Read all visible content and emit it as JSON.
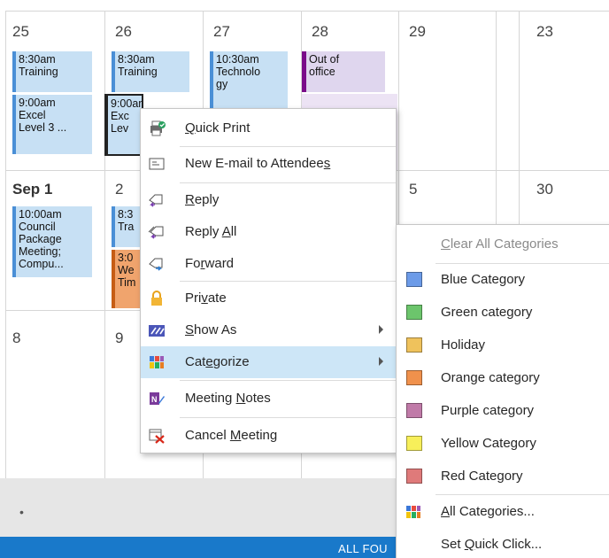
{
  "calendar": {
    "row1": [
      "25",
      "26",
      "27",
      "28",
      "29",
      "23"
    ],
    "row2": [
      "Sep 1",
      "2",
      "",
      "",
      "5",
      "30"
    ],
    "row3": [
      "8",
      "9"
    ],
    "events": {
      "e25a": [
        "8:30am",
        "Training"
      ],
      "e25b": [
        "9:00am",
        "Excel",
        "Level 3 ..."
      ],
      "e26a": [
        "8:30am",
        "Training"
      ],
      "e26b": [
        "9:00am",
        "Exc",
        "Lev"
      ],
      "e27a": [
        "10:30am",
        "Technolo",
        "gy"
      ],
      "e28a": [
        "Out of",
        "office"
      ],
      "e1a": [
        "10:00am",
        "Council",
        "Package",
        "Meeting;",
        "Compu..."
      ],
      "e2a": [
        "8:3",
        "Tra"
      ],
      "e2b": [
        "3:0",
        "We",
        "Tim"
      ]
    },
    "bottom_dot": "•",
    "strip_text": "ALL FOU"
  },
  "context_menu": {
    "items": [
      {
        "pre": "",
        "u": "Q",
        "post": "uick Print",
        "icon": "quick-print-icon"
      },
      {
        "pre": "New E-mail to Attendee",
        "u": "s",
        "post": "",
        "icon": "email-icon"
      },
      {
        "pre": "",
        "u": "R",
        "post": "eply",
        "icon": "reply-icon"
      },
      {
        "pre": "Reply ",
        "u": "A",
        "post": "ll",
        "icon": "reply-all-icon"
      },
      {
        "pre": "Fo",
        "u": "r",
        "post": "ward",
        "icon": "forward-icon"
      },
      {
        "pre": "Pri",
        "u": "v",
        "post": "ate",
        "icon": "lock-icon"
      },
      {
        "pre": "",
        "u": "S",
        "post": "how As",
        "icon": "show-as-icon"
      },
      {
        "pre": "Cat",
        "u": "e",
        "post": "gorize",
        "icon": "categorize-icon"
      },
      {
        "pre": "Meeting ",
        "u": "N",
        "post": "otes",
        "icon": "onenote-icon"
      },
      {
        "pre": "Cancel ",
        "u": "M",
        "post": "eeting",
        "icon": "cancel-meeting-icon"
      }
    ]
  },
  "submenu": {
    "clear": {
      "pre": "",
      "u": "C",
      "post": "lear All Categories"
    },
    "categories": [
      {
        "label": "Blue Category",
        "color": "#6c9be8"
      },
      {
        "label": "Green category",
        "color": "#6cc56c"
      },
      {
        "label": "Holiday",
        "color": "#efc25c"
      },
      {
        "label": "Orange category",
        "color": "#f0914c"
      },
      {
        "label": "Purple category",
        "color": "#c07aa8"
      },
      {
        "label": "Yellow Category",
        "color": "#f7ef5a"
      },
      {
        "label": "Red Category",
        "color": "#df7a7a"
      }
    ],
    "all": {
      "pre": "",
      "u": "A",
      "post": "ll Categories..."
    },
    "quick": {
      "pre": "Set ",
      "u": "Q",
      "post": "uick Click..."
    }
  }
}
